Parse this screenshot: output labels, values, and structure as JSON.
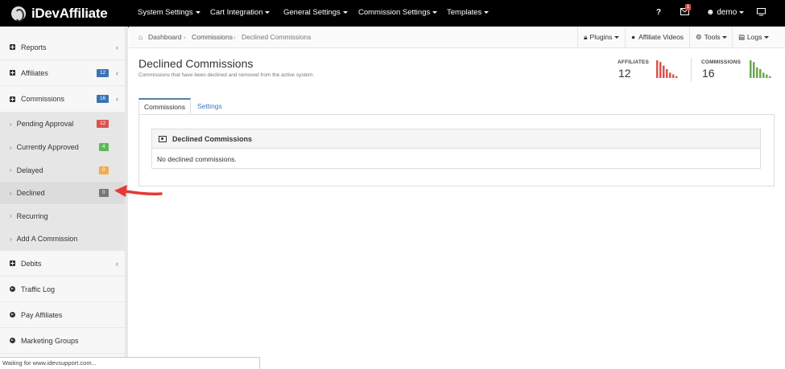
{
  "app": {
    "logo_text": "iDevAffiliate"
  },
  "topnav": {
    "items": [
      "System Settings",
      "Cart Integration",
      "General Settings",
      "Commission Settings",
      "Templates"
    ],
    "mail_badge": "1",
    "user": "demo"
  },
  "sidebar": {
    "reports": "Reports",
    "affiliates": {
      "label": "Affiliates",
      "badge": "12"
    },
    "commissions": {
      "label": "Commissions",
      "badge": "16"
    },
    "sub": [
      {
        "label": "Pending Approval",
        "badge": "12",
        "color": "#d9534f"
      },
      {
        "label": "Currently Approved",
        "badge": "4",
        "color": "#5cb85c"
      },
      {
        "label": "Delayed",
        "badge": "0",
        "color": "#f0ad4e"
      },
      {
        "label": "Declined",
        "badge": "0",
        "color": "#777777"
      },
      {
        "label": "Recurring"
      },
      {
        "label": "Add A Commission"
      }
    ],
    "debits": "Debits",
    "traffic_log": "Traffic Log",
    "pay_affiliates": "Pay Affiliates",
    "marketing_groups": "Marketing Groups"
  },
  "breadcrumb": {
    "dashboard": "Dashboard",
    "commissions": "Commissions",
    "current": "Declined Commissions"
  },
  "toolbar": {
    "plugins": "Plugins",
    "videos": "Affiliate Videos",
    "tools": "Tools",
    "logs": "Logs"
  },
  "header": {
    "title": "Declined Commissions",
    "subtitle": "Commissions that have been declined and removed from the active system."
  },
  "stats": {
    "affiliates": {
      "label": "AFFILIATES",
      "value": "12",
      "color": "#d9534f",
      "bars": [
        10,
        9,
        7,
        5,
        3,
        2,
        1
      ]
    },
    "commissions": {
      "label": "COMMISSIONS",
      "value": "16",
      "color": "#6aa84f",
      "bars": [
        10,
        9,
        6,
        5,
        3,
        2,
        1
      ]
    }
  },
  "tabs": {
    "commissions": "Commissions",
    "settings": "Settings"
  },
  "panel": {
    "title": "Declined Commissions",
    "empty": "No declined commissions."
  },
  "status": "Waiting for www.idevsupport.com..."
}
